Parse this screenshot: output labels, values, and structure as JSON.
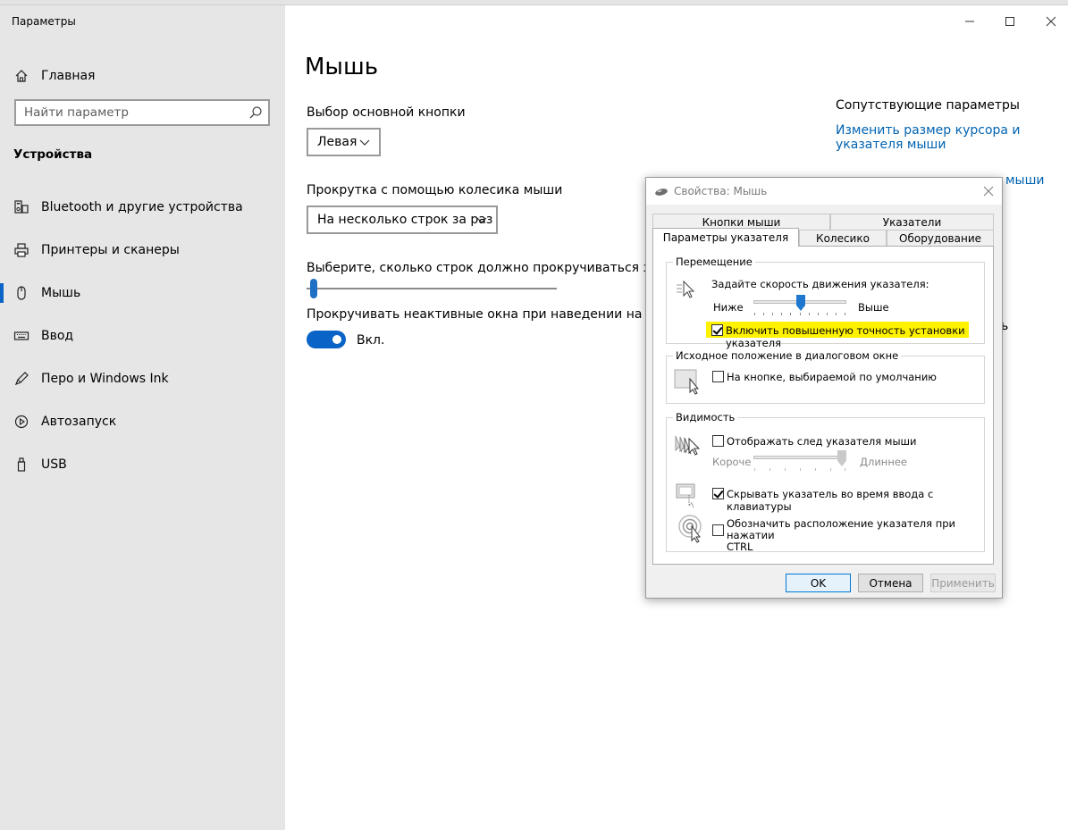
{
  "window": {
    "title": "Параметры"
  },
  "sidebar": {
    "home_label": "Главная",
    "search_placeholder": "Найти параметр",
    "section_title": "Устройства",
    "items": [
      {
        "label": "Bluetooth и другие устройства",
        "icon": "bluetooth-devices-icon"
      },
      {
        "label": "Принтеры и сканеры",
        "icon": "printer-icon"
      },
      {
        "label": "Мышь",
        "icon": "mouse-icon",
        "active": true
      },
      {
        "label": "Ввод",
        "icon": "keyboard-icon"
      },
      {
        "label": "Перо и Windows Ink",
        "icon": "pen-icon"
      },
      {
        "label": "Автозапуск",
        "icon": "autoplay-icon"
      },
      {
        "label": "USB",
        "icon": "usb-icon"
      }
    ]
  },
  "main": {
    "title": "Мышь",
    "primary_button_label": "Выбор основной кнопки",
    "primary_button_value": "Левая",
    "scroll_label": "Прокрутка с помощью колесика мыши",
    "scroll_value": "На несколько строк за раз",
    "lines_label": "Выберите, сколько строк должно прокручиваться за один",
    "inactive_scroll_label": "Прокручивать неактивные окна при наведении на них",
    "inactive_scroll_state": "Вкл.",
    "lines_slider_level": 0.02,
    "inactive_scroll_on": true
  },
  "related": {
    "title": "Сопутствующие параметры",
    "link1_line1": "Изменить размер курсора и",
    "link1_line2": "указателя мыши",
    "link2_partial": "мыши",
    "hidden_fragment": "ь"
  },
  "dialog": {
    "title": "Свойства: Мышь",
    "tabs_row1": [
      "Кнопки мыши",
      "Указатели"
    ],
    "tabs_row2": [
      "Параметры указателя",
      "Колесико",
      "Оборудование"
    ],
    "active_tab": "Параметры указателя",
    "motion": {
      "group": "Перемещение",
      "speed_label": "Задайте скорость движения указателя:",
      "slower": "Ниже",
      "faster": "Выше",
      "speed_level": 0.5,
      "precision_label": "Включить повышенную точность установки указателя",
      "precision_checked": true
    },
    "snap": {
      "group": "Исходное положение в диалоговом окне",
      "label": "На кнопке, выбираемой по умолчанию",
      "checked": false
    },
    "visibility": {
      "group": "Видимость",
      "trails_label": "Отображать след указателя мыши",
      "trails_checked": false,
      "short": "Короче",
      "long": "Длиннее",
      "trails_level": 1.0,
      "hide_label": "Скрывать указатель во время ввода с клавиатуры",
      "hide_checked": true,
      "ctrl_label_line1": "Обозначить расположение указателя при нажатии",
      "ctrl_label_line2": "CTRL",
      "ctrl_checked": false
    },
    "buttons": {
      "ok": "OK",
      "cancel": "Отмена",
      "apply": "Применить"
    }
  },
  "colors": {
    "accent": "#0a64c8",
    "link": "#0063b1",
    "highlight": "#fff200",
    "sidebar_bg": "#e6e6e6"
  }
}
